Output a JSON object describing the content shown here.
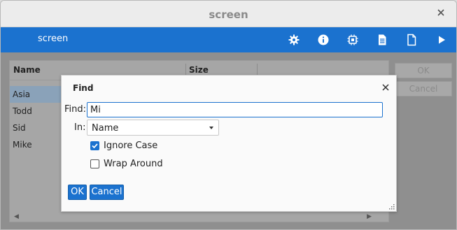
{
  "window": {
    "title": "screen"
  },
  "toolbar": {
    "title": "screen",
    "icons": [
      "gear-icon",
      "info-icon",
      "chip-icon",
      "document-icon",
      "file-icon",
      "play-icon"
    ]
  },
  "table": {
    "columns": [
      "Name",
      "Size"
    ],
    "rows": [
      "Asia",
      "Todd",
      "Sid",
      "Mike"
    ],
    "selected_row": "Asia"
  },
  "side_buttons": {
    "ok": "OK",
    "cancel": "Cancel"
  },
  "dialog": {
    "title": "Find",
    "find_label": "Find:",
    "find_value": "Mi",
    "in_label": "In:",
    "in_value": "Name",
    "ignore_case_label": "Ignore Case",
    "ignore_case_checked": true,
    "wrap_around_label": "Wrap Around",
    "wrap_around_checked": false,
    "ok_label": "OK",
    "cancel_label": "Cancel"
  },
  "colors": {
    "accent": "#1b72cf",
    "selection": "#8aa2b9"
  }
}
